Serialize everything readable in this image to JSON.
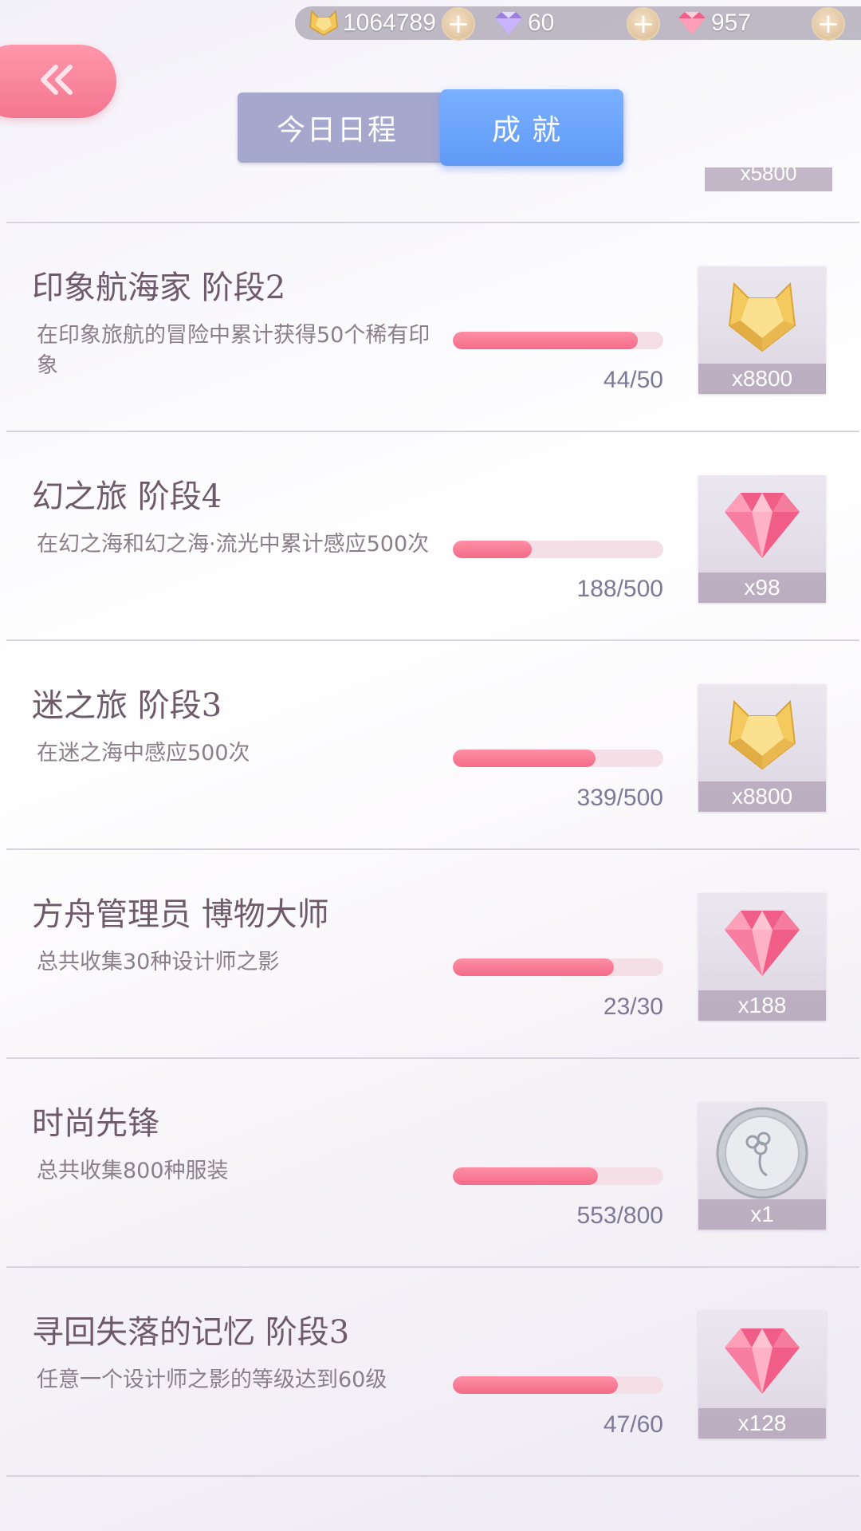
{
  "resources": [
    {
      "icon": "cat-crystal-icon",
      "value": "1064789"
    },
    {
      "icon": "purple-diamond-icon",
      "value": "60"
    },
    {
      "icon": "pink-diamond-icon",
      "value": "957"
    }
  ],
  "tabs": {
    "today": "今日日程",
    "achievements": "成就"
  },
  "partial_reward_qty": "x5800",
  "achievements": [
    {
      "title": "印象航海家 阶段2",
      "desc": "在印象旅航的冒险中累计获得50个稀有印象",
      "progress_text": "44/50",
      "progress": 0.88,
      "reward_icon": "gold-cat-crystal-icon",
      "reward_qty": "x8800"
    },
    {
      "title": "幻之旅 阶段4",
      "desc": "在幻之海和幻之海·流光中累计感应500次",
      "progress_text": "188/500",
      "progress": 0.376,
      "reward_icon": "pink-diamond-icon",
      "reward_qty": "x98"
    },
    {
      "title": "迷之旅 阶段3",
      "desc": "在迷之海中感应500次",
      "progress_text": "339/500",
      "progress": 0.678,
      "reward_icon": "gold-cat-crystal-icon",
      "reward_qty": "x8800"
    },
    {
      "title": "方舟管理员 博物大师",
      "desc": "总共收集30种设计师之影",
      "progress_text": "23/30",
      "progress": 0.767,
      "reward_icon": "pink-diamond-icon",
      "reward_qty": "x188"
    },
    {
      "title": "时尚先锋",
      "desc": "总共收集800种服装",
      "progress_text": "553/800",
      "progress": 0.691,
      "reward_icon": "silver-coin-icon",
      "reward_qty": "x1"
    },
    {
      "title": "寻回失落的记忆 阶段3",
      "desc": "任意一个设计师之影的等级达到60级",
      "progress_text": "47/60",
      "progress": 0.783,
      "reward_icon": "pink-diamond-icon",
      "reward_qty": "x128"
    }
  ]
}
